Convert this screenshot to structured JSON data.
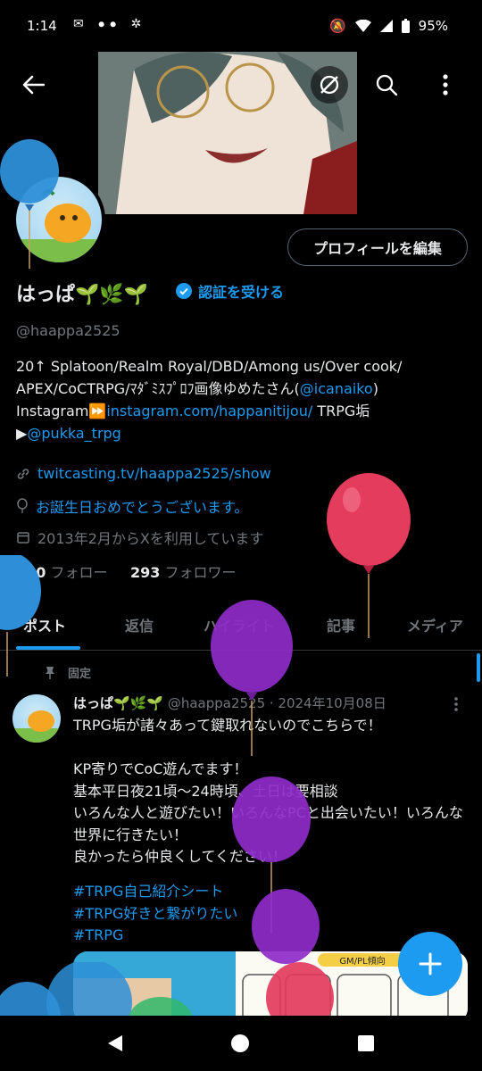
{
  "status_bar": {
    "time": "1:14",
    "battery": "95%"
  },
  "header": {
    "back_icon": "arrow-left-icon",
    "actions": [
      "no-preview-icon",
      "search-icon",
      "more-vertical-icon"
    ]
  },
  "profile": {
    "edit_button": "プロフィールを編集",
    "name": "はっぱ🌱🌿🌱",
    "verify_label": "認証を受ける",
    "handle": "@haappa2525",
    "bio": {
      "line1": "20↑ Splatoon/Realm Royal/DBD/Among us/Over cook/",
      "line2a": "APEX/CoCTRPG/ﾏﾀﾞﾐｽﾌﾟﾛﾌ画像ゆめたさん(",
      "line2_link": "@icanaiko",
      "line2b": ")",
      "line3a": "Instagram⏩",
      "line3_link": "instagram.com/happanitijou/",
      "line3b": " TRPG垢",
      "line4a": "▶",
      "line4_link": "@pukka_trpg"
    },
    "website": "twitcasting.tv/haappa2525/show",
    "birthday": "お誕生日おめでとうございます。",
    "joined": "2013年2月からXを利用しています",
    "following_count": "720",
    "following_label": "フォロー",
    "followers_count": "293",
    "followers_label": "フォロワー"
  },
  "tabs": [
    "ポスト",
    "返信",
    "ハイライト",
    "記事",
    "メディア"
  ],
  "pinned_tweet": {
    "pinned_label": "固定",
    "name": "はっぱ🌱🌿🌱",
    "handle_date": "@haappa2525 · 2024年10月08日",
    "text": "TRPG垢が諸々あって鍵取れないのでこちらで！\n\nKP寄りでCoC遊んでます！\n基本平日夜21頃〜24時頃、土日は要相談\nいろんな人と遊びたい！いろんなPCと出会いたい！いろんな世界に行きたい！\n良かったら仲良くしてください！",
    "hashtags": [
      "#TRPG自己紹介シート",
      "#TRPG好きと繋がりたい",
      "#TRPG"
    ],
    "media_label": "GM/PL傾向"
  },
  "fab": {
    "icon": "plus-icon"
  },
  "colors": {
    "accent": "#1d9bf0",
    "background": "#000000",
    "muted": "#71767b"
  }
}
